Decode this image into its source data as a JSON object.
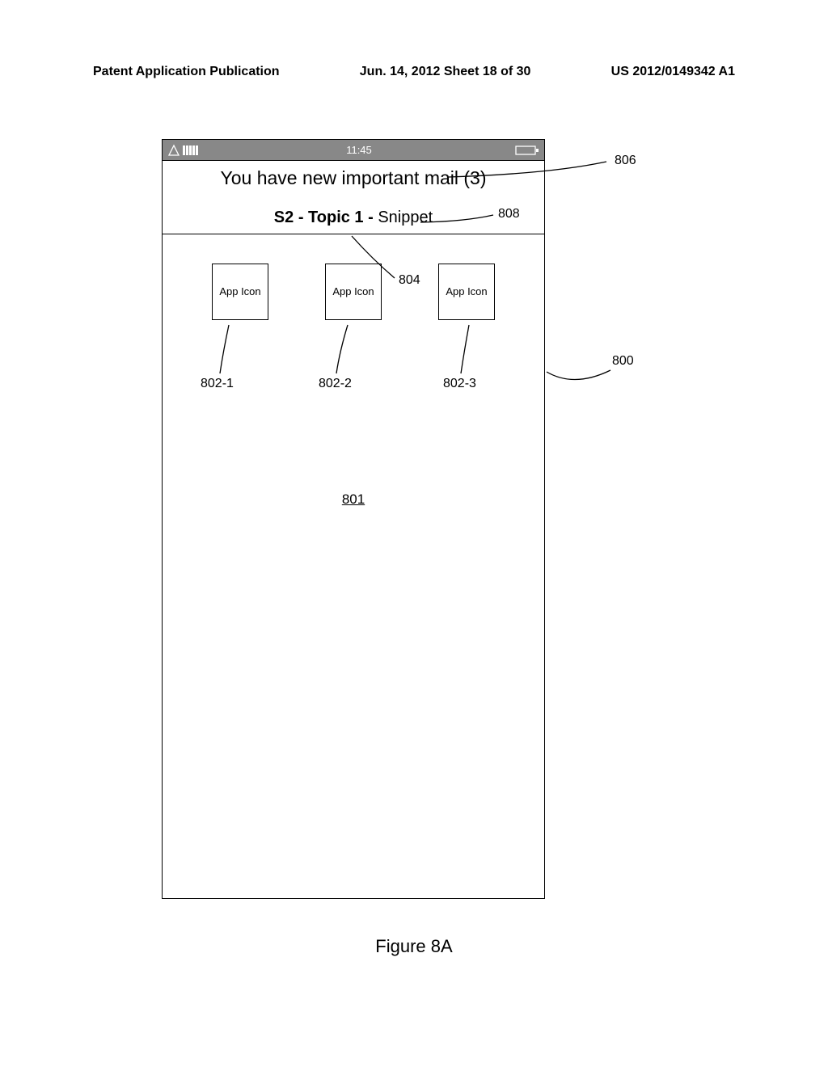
{
  "header": {
    "left": "Patent Application Publication",
    "center": "Jun. 14, 2012  Sheet 18 of 30",
    "right": "US 2012/0149342 A1"
  },
  "status_bar": {
    "time": "11:45"
  },
  "notification": {
    "title": "You have new important mail (3)",
    "snippet_bold": "S2 - Topic 1 - ",
    "snippet_rest": "Snippet"
  },
  "apps": [
    {
      "label": "App\nIcon"
    },
    {
      "label": "App\nIcon"
    },
    {
      "label": "App\nIcon"
    }
  ],
  "refs": {
    "r800": "800",
    "r801": "801",
    "r802_1": "802-1",
    "r802_2": "802-2",
    "r802_3": "802-3",
    "r804": "804",
    "r806": "806",
    "r808": "808"
  },
  "figure_caption": "Figure 8A"
}
